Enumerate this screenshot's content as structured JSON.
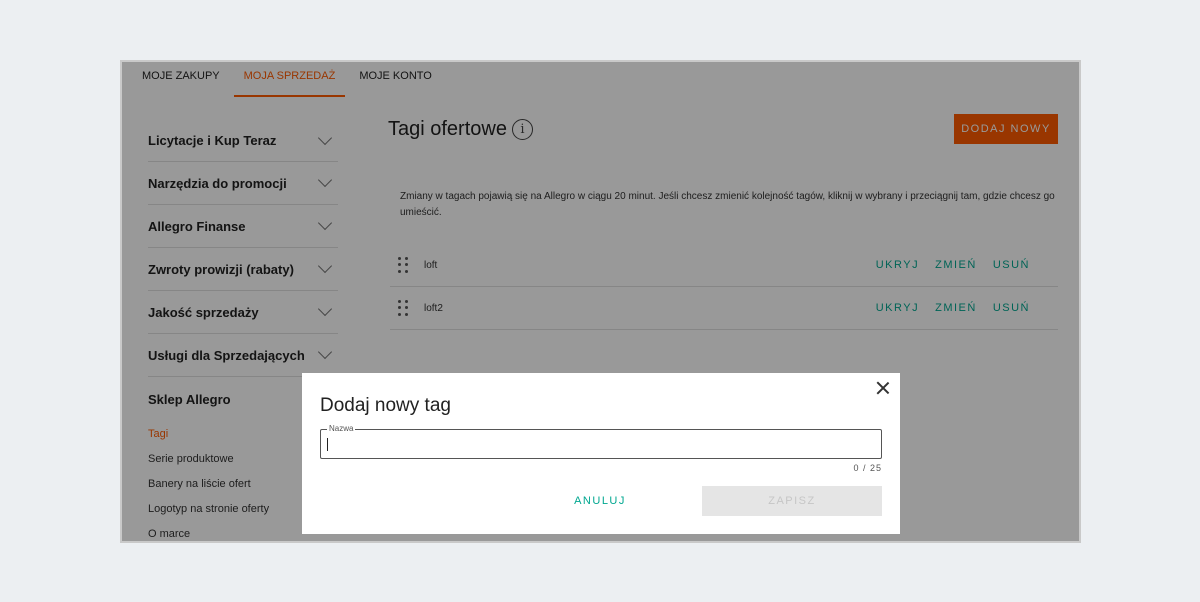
{
  "topnav": {
    "tabs": [
      {
        "label": "MOJE ZAKUPY",
        "active": false
      },
      {
        "label": "MOJA SPRZEDAŻ",
        "active": true
      },
      {
        "label": "MOJE KONTO",
        "active": false
      }
    ]
  },
  "sidebar": {
    "sections": [
      {
        "label": "Licytacje i Kup Teraz",
        "icon": "chevron-down-icon"
      },
      {
        "label": "Narzędzia do promocji",
        "icon": "chevron-down-icon"
      },
      {
        "label": "Allegro Finanse",
        "icon": "chevron-down-icon"
      },
      {
        "label": "Zwroty prowizji (rabaty)",
        "icon": "chevron-down-icon"
      },
      {
        "label": "Jakość sprzedaży",
        "icon": "chevron-down-icon"
      },
      {
        "label": "Usługi dla Sprzedających",
        "icon": "chevron-down-icon"
      }
    ],
    "open_section": "Sklep Allegro",
    "links": [
      {
        "label": "Tagi",
        "active": true
      },
      {
        "label": "Serie produktowe",
        "active": false
      },
      {
        "label": "Banery na liście ofert",
        "active": false
      },
      {
        "label": "Logotyp na stronie oferty",
        "active": false
      },
      {
        "label": "O marce",
        "active": false
      }
    ]
  },
  "main": {
    "title": "Tagi ofertowe",
    "info_icon": "i",
    "add_button": "DODAJ NOWY",
    "notice": "Zmiany w tagach pojawią się na Allegro w ciągu 20 minut. Jeśli chcesz zmienić kolejność tagów, kliknij w wybrany i przeciągnij tam, gdzie chcesz go umieścić.",
    "tags": [
      {
        "name": "loft",
        "hide": "UKRYJ",
        "edit": "ZMIEŃ",
        "delete": "USUŃ"
      },
      {
        "name": "loft2",
        "hide": "UKRYJ",
        "edit": "ZMIEŃ",
        "delete": "USUŃ"
      }
    ]
  },
  "modal": {
    "title": "Dodaj nowy tag",
    "field_label": "Nazwa",
    "field_value": "",
    "counter": "0 / 25",
    "cancel": "ANULUJ",
    "save": "ZAPISZ"
  },
  "colors": {
    "accent": "#ff5a00",
    "action": "#00a790",
    "overlay": "rgba(0,0,0,0.4)"
  }
}
